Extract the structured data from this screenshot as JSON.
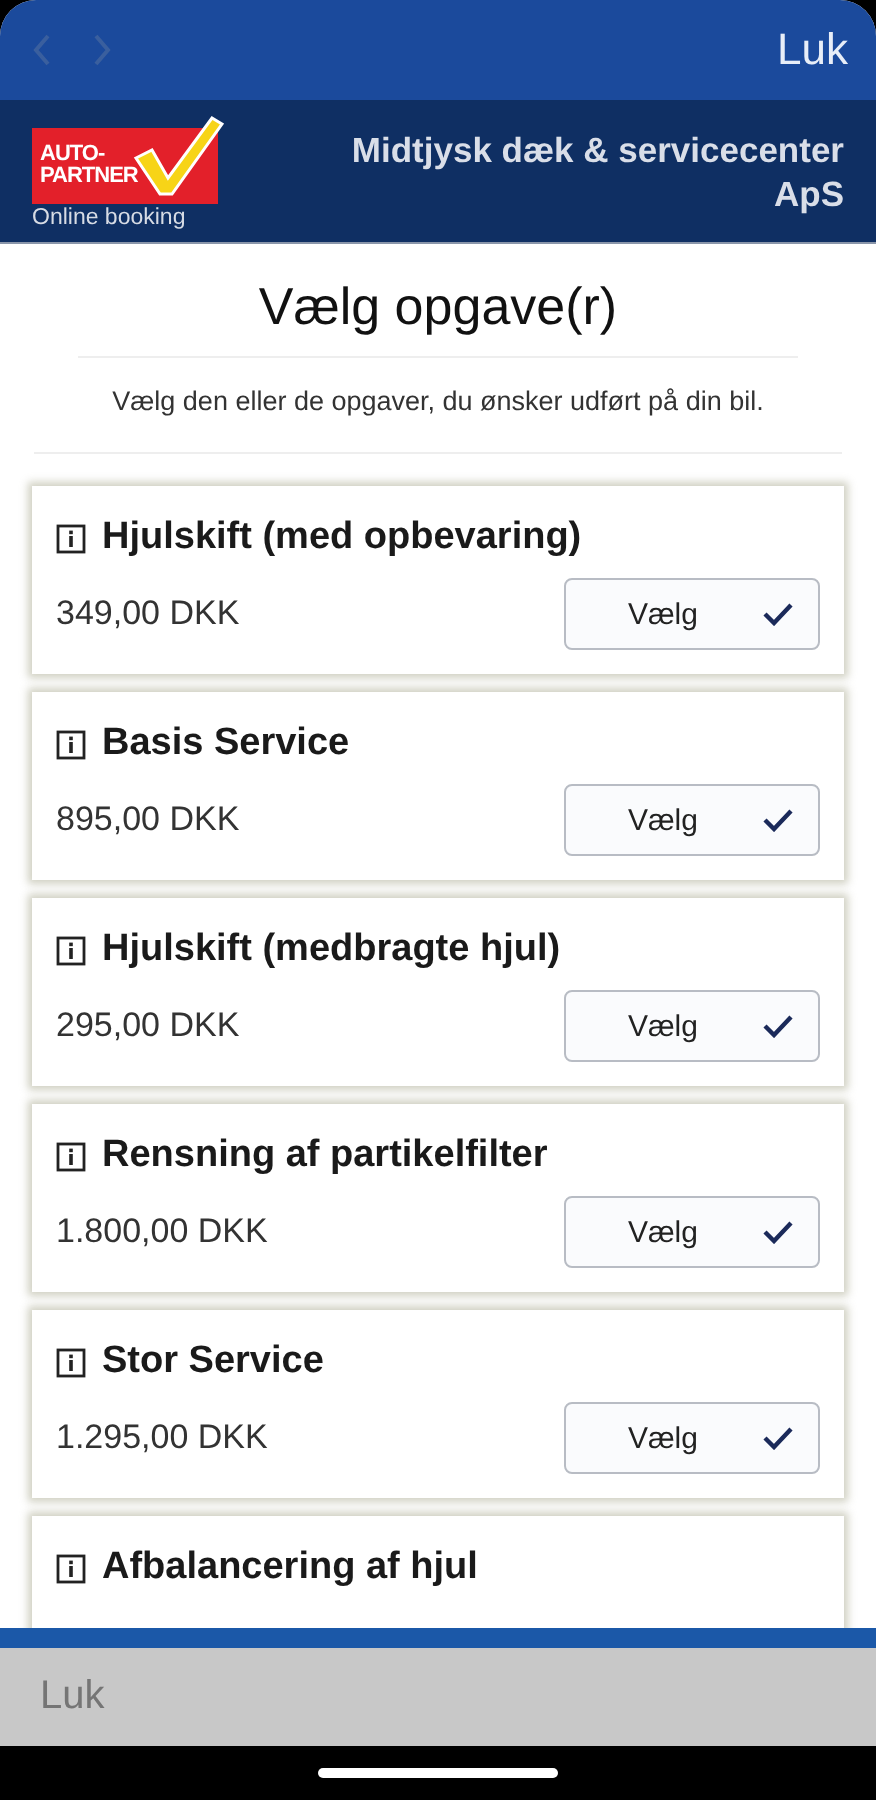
{
  "top_bar": {
    "close": "Luk"
  },
  "header": {
    "logo": {
      "line1": "AUTO-",
      "line2": "PARTNER",
      "caption": "Online booking"
    },
    "company": "Midtjysk dæk & servicecenter ApS"
  },
  "page": {
    "title": "Vælg opgave(r)",
    "intro": "Vælg den eller de opgaver, du ønsker udført på din bil."
  },
  "tasks": [
    {
      "name": "Hjulskift (med opbevaring)",
      "price": "349,00 DKK",
      "button": "Vælg"
    },
    {
      "name": "Basis Service",
      "price": "895,00 DKK",
      "button": "Vælg"
    },
    {
      "name": "Hjulskift (medbragte hjul)",
      "price": "295,00 DKK",
      "button": "Vælg"
    },
    {
      "name": "Rensning af partikelfilter",
      "price": "1.800,00 DKK",
      "button": "Vælg"
    },
    {
      "name": "Stor Service",
      "price": "1.295,00 DKK",
      "button": "Vælg"
    },
    {
      "name": "Afbalancering af hjul"
    }
  ],
  "bottom_bar": {
    "close": "Luk"
  }
}
